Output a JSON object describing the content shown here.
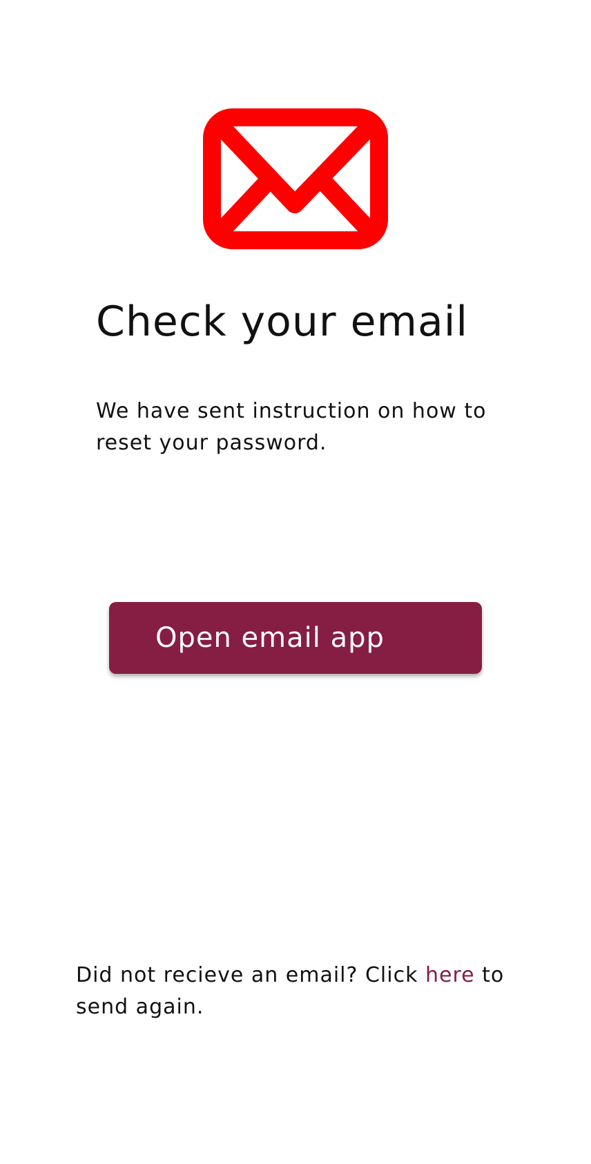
{
  "icon": "envelope-icon",
  "title": "Check your email",
  "subtitle": "We have sent instruction on how to reset your password.",
  "open_button_label": "Open email app",
  "resend": {
    "prefix": "Did not recieve an email? Click ",
    "link_text": "here",
    "suffix": " to send again."
  },
  "colors": {
    "icon": "#ff0000",
    "accent": "#851e42",
    "text": "#111111",
    "background": "#ffffff"
  }
}
